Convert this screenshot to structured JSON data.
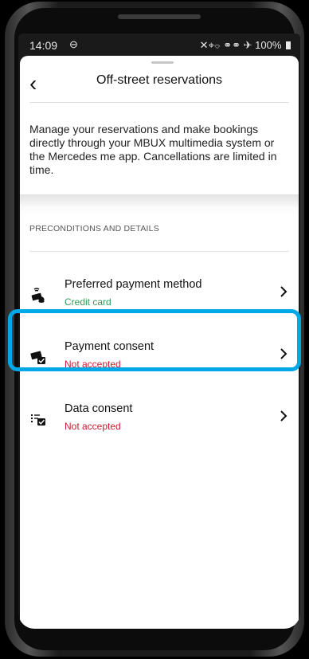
{
  "status": {
    "time": "14:09",
    "dnd_symbol": "⊖",
    "icons": "✕⌖⌔ ⚭⚭ ✈",
    "battery": "100%"
  },
  "header": {
    "back_symbol": "‹",
    "title": "Off-street reservations"
  },
  "intro": {
    "text": "Manage your reservations and make bookings directly through your MBUX multimedia system or the Mercedes me app. Cancellations are limited in time."
  },
  "section": {
    "label": "PRECONDITIONS AND DETAILS"
  },
  "rows": [
    {
      "title": "Preferred payment method",
      "subtitle": "Credit card",
      "icon": "payment-method-icon",
      "status_color": "#2e9b55"
    },
    {
      "title": "Payment consent",
      "subtitle": "Not accepted",
      "icon": "payment-consent-icon",
      "status_color": "#c42131",
      "highlighted": true
    },
    {
      "title": "Data consent",
      "subtitle": "Not accepted",
      "icon": "data-consent-icon",
      "status_color": "#c42131"
    }
  ],
  "chevron_symbol": "›",
  "colors": {
    "accent_highlight": "#00a8e8",
    "positive": "#2e9b55",
    "negative": "#c42131"
  }
}
